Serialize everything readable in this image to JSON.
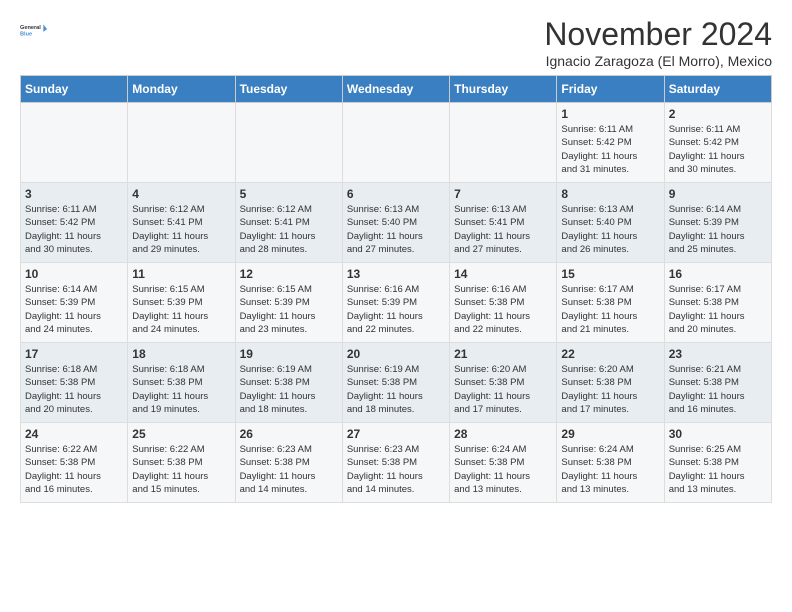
{
  "header": {
    "logo_line1": "General",
    "logo_line2": "Blue",
    "month_title": "November 2024",
    "location": "Ignacio Zaragoza (El Morro), Mexico"
  },
  "days_of_week": [
    "Sunday",
    "Monday",
    "Tuesday",
    "Wednesday",
    "Thursday",
    "Friday",
    "Saturday"
  ],
  "weeks": [
    {
      "days": [
        {
          "num": "",
          "info": ""
        },
        {
          "num": "",
          "info": ""
        },
        {
          "num": "",
          "info": ""
        },
        {
          "num": "",
          "info": ""
        },
        {
          "num": "",
          "info": ""
        },
        {
          "num": "1",
          "info": "Sunrise: 6:11 AM\nSunset: 5:42 PM\nDaylight: 11 hours\nand 31 minutes."
        },
        {
          "num": "2",
          "info": "Sunrise: 6:11 AM\nSunset: 5:42 PM\nDaylight: 11 hours\nand 30 minutes."
        }
      ]
    },
    {
      "days": [
        {
          "num": "3",
          "info": "Sunrise: 6:11 AM\nSunset: 5:42 PM\nDaylight: 11 hours\nand 30 minutes."
        },
        {
          "num": "4",
          "info": "Sunrise: 6:12 AM\nSunset: 5:41 PM\nDaylight: 11 hours\nand 29 minutes."
        },
        {
          "num": "5",
          "info": "Sunrise: 6:12 AM\nSunset: 5:41 PM\nDaylight: 11 hours\nand 28 minutes."
        },
        {
          "num": "6",
          "info": "Sunrise: 6:13 AM\nSunset: 5:40 PM\nDaylight: 11 hours\nand 27 minutes."
        },
        {
          "num": "7",
          "info": "Sunrise: 6:13 AM\nSunset: 5:41 PM\nDaylight: 11 hours\nand 27 minutes."
        },
        {
          "num": "8",
          "info": "Sunrise: 6:13 AM\nSunset: 5:40 PM\nDaylight: 11 hours\nand 26 minutes."
        },
        {
          "num": "9",
          "info": "Sunrise: 6:14 AM\nSunset: 5:39 PM\nDaylight: 11 hours\nand 25 minutes."
        }
      ]
    },
    {
      "days": [
        {
          "num": "10",
          "info": "Sunrise: 6:14 AM\nSunset: 5:39 PM\nDaylight: 11 hours\nand 24 minutes."
        },
        {
          "num": "11",
          "info": "Sunrise: 6:15 AM\nSunset: 5:39 PM\nDaylight: 11 hours\nand 24 minutes."
        },
        {
          "num": "12",
          "info": "Sunrise: 6:15 AM\nSunset: 5:39 PM\nDaylight: 11 hours\nand 23 minutes."
        },
        {
          "num": "13",
          "info": "Sunrise: 6:16 AM\nSunset: 5:39 PM\nDaylight: 11 hours\nand 22 minutes."
        },
        {
          "num": "14",
          "info": "Sunrise: 6:16 AM\nSunset: 5:38 PM\nDaylight: 11 hours\nand 22 minutes."
        },
        {
          "num": "15",
          "info": "Sunrise: 6:17 AM\nSunset: 5:38 PM\nDaylight: 11 hours\nand 21 minutes."
        },
        {
          "num": "16",
          "info": "Sunrise: 6:17 AM\nSunset: 5:38 PM\nDaylight: 11 hours\nand 20 minutes."
        }
      ]
    },
    {
      "days": [
        {
          "num": "17",
          "info": "Sunrise: 6:18 AM\nSunset: 5:38 PM\nDaylight: 11 hours\nand 20 minutes."
        },
        {
          "num": "18",
          "info": "Sunrise: 6:18 AM\nSunset: 5:38 PM\nDaylight: 11 hours\nand 19 minutes."
        },
        {
          "num": "19",
          "info": "Sunrise: 6:19 AM\nSunset: 5:38 PM\nDaylight: 11 hours\nand 18 minutes."
        },
        {
          "num": "20",
          "info": "Sunrise: 6:19 AM\nSunset: 5:38 PM\nDaylight: 11 hours\nand 18 minutes."
        },
        {
          "num": "21",
          "info": "Sunrise: 6:20 AM\nSunset: 5:38 PM\nDaylight: 11 hours\nand 17 minutes."
        },
        {
          "num": "22",
          "info": "Sunrise: 6:20 AM\nSunset: 5:38 PM\nDaylight: 11 hours\nand 17 minutes."
        },
        {
          "num": "23",
          "info": "Sunrise: 6:21 AM\nSunset: 5:38 PM\nDaylight: 11 hours\nand 16 minutes."
        }
      ]
    },
    {
      "days": [
        {
          "num": "24",
          "info": "Sunrise: 6:22 AM\nSunset: 5:38 PM\nDaylight: 11 hours\nand 16 minutes."
        },
        {
          "num": "25",
          "info": "Sunrise: 6:22 AM\nSunset: 5:38 PM\nDaylight: 11 hours\nand 15 minutes."
        },
        {
          "num": "26",
          "info": "Sunrise: 6:23 AM\nSunset: 5:38 PM\nDaylight: 11 hours\nand 14 minutes."
        },
        {
          "num": "27",
          "info": "Sunrise: 6:23 AM\nSunset: 5:38 PM\nDaylight: 11 hours\nand 14 minutes."
        },
        {
          "num": "28",
          "info": "Sunrise: 6:24 AM\nSunset: 5:38 PM\nDaylight: 11 hours\nand 13 minutes."
        },
        {
          "num": "29",
          "info": "Sunrise: 6:24 AM\nSunset: 5:38 PM\nDaylight: 11 hours\nand 13 minutes."
        },
        {
          "num": "30",
          "info": "Sunrise: 6:25 AM\nSunset: 5:38 PM\nDaylight: 11 hours\nand 13 minutes."
        }
      ]
    }
  ]
}
